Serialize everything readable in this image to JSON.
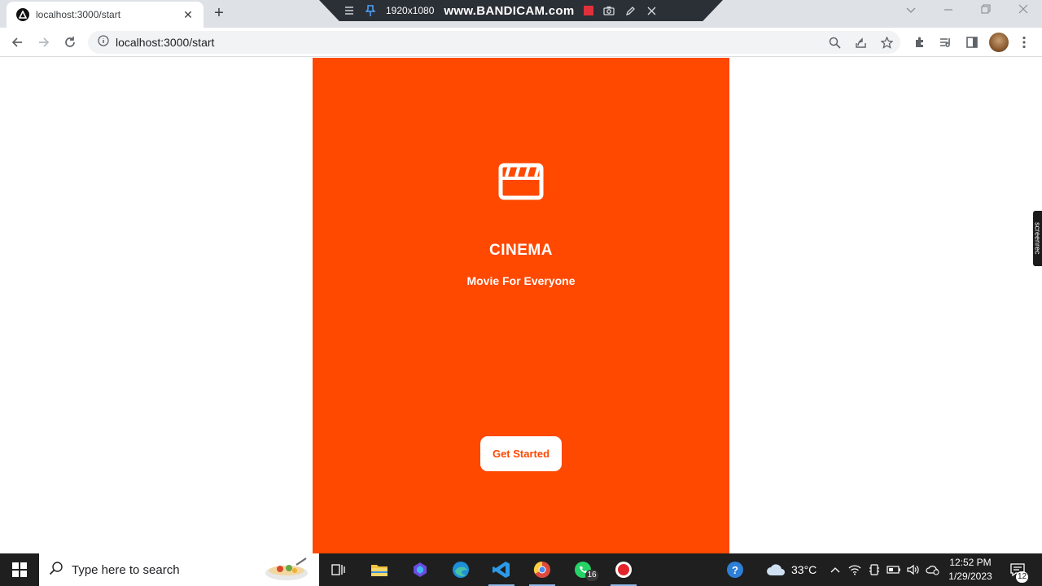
{
  "browser": {
    "tab_title": "localhost:3000/start",
    "tab_close": "✕",
    "new_tab": "+",
    "url": "localhost:3000/start"
  },
  "recorder": {
    "resolution": "1920x1080",
    "brand": "www.BANDICAM.com"
  },
  "page": {
    "title": "CINEMA",
    "tagline": "Movie For Everyone",
    "cta_label": "Get Started",
    "accent_color": "#ff4800"
  },
  "side_widget": {
    "label": "screenrec"
  },
  "taskbar": {
    "search_placeholder": "Type here to search",
    "whatsapp_badge": "16",
    "temperature": "33°C",
    "time": "12:52 PM",
    "date": "1/29/2023",
    "notification_count": "12"
  }
}
